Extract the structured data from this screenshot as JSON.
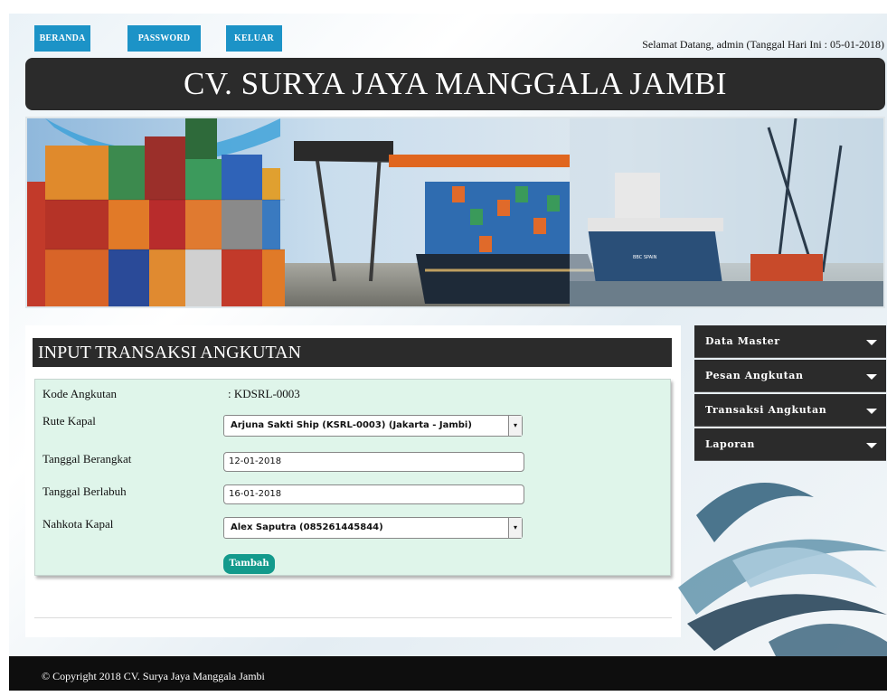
{
  "nav": {
    "beranda": "BERANDA",
    "password": "PASSWORD",
    "keluar": "KELUAR"
  },
  "welcome": "Selamat Datang, admin (Tanggal Hari Ini : 05-01-2018)",
  "site_title": "CV. SURYA JAYA MANGGALA JAMBI",
  "form": {
    "title": "INPUT TRANSAKSI ANGKUTAN",
    "kode_label": "Kode Angkutan",
    "kode_value": ": KDSRL-0003",
    "rute_label": "Rute Kapal",
    "rute_value": "Arjuna Sakti Ship (KSRL-0003) (Jakarta - Jambi)",
    "berangkat_label": "Tanggal Berangkat",
    "berangkat_value": "12-01-2018",
    "berlabuh_label": "Tanggal Berlabuh",
    "berlabuh_value": "16-01-2018",
    "nahkota_label": "Nahkota Kapal",
    "nahkota_value": "Alex Saputra (085261445844)",
    "submit": "Tambah"
  },
  "menu": {
    "data_master": "Data Master",
    "pesan_angkutan": "Pesan Angkutan",
    "transaksi_angkutan": "Transaksi Angkutan",
    "laporan": "Laporan"
  },
  "footer": "© Copyright 2018 CV. Surya Jaya Manggala Jambi",
  "colors": {
    "nav_button": "#1c93c7",
    "header_dark": "#2b2b2b",
    "form_bg": "#dff5ea",
    "submit_button": "#139a8c"
  },
  "icons": {
    "dropdown": "chevron-down-icon",
    "menu_caret": "caret-down-icon"
  }
}
